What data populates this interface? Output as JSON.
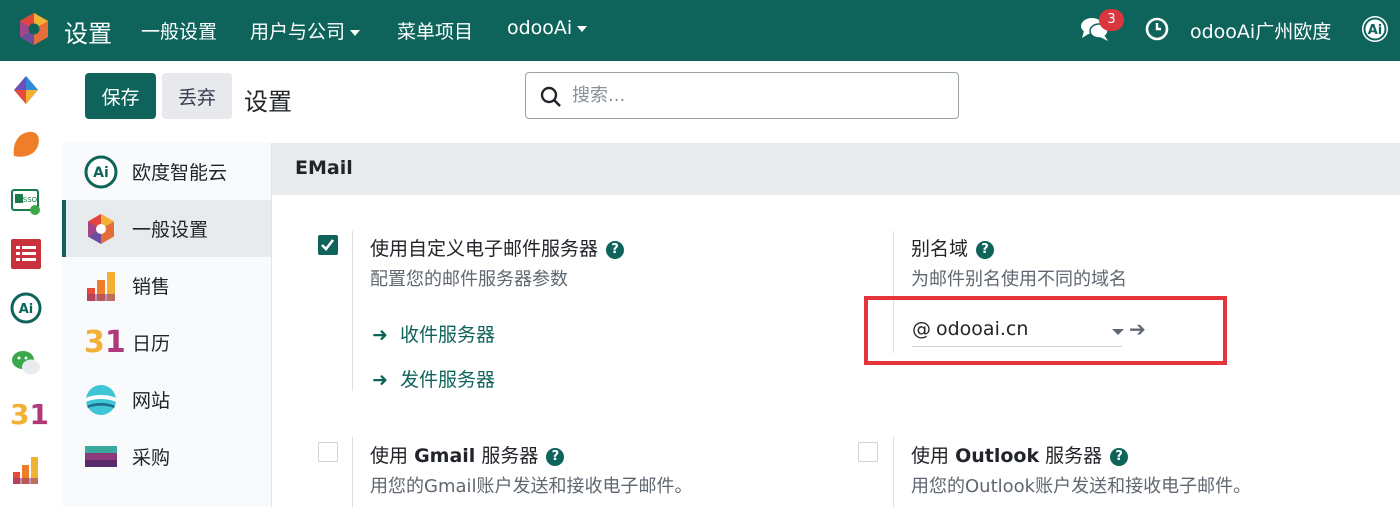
{
  "topbar": {
    "app_title": "设置",
    "nav": [
      {
        "label": "一般设置",
        "has_caret": false
      },
      {
        "label": "用户与公司",
        "has_caret": true
      },
      {
        "label": "菜单项目",
        "has_caret": false
      },
      {
        "label": "odooAi",
        "has_caret": true
      }
    ],
    "message_count": "3",
    "user_name": "odooAi广州欧度"
  },
  "control_panel": {
    "save_label": "保存",
    "discard_label": "丢弃",
    "title": "设置",
    "search_placeholder": "搜索..."
  },
  "sidebar": {
    "items": [
      {
        "label": "欧度智能云",
        "icon": "odoo-ai-icon"
      },
      {
        "label": "一般设置",
        "icon": "general-settings-icon",
        "active": true
      },
      {
        "label": "销售",
        "icon": "sales-icon"
      },
      {
        "label": "日历",
        "icon": "calendar-icon"
      },
      {
        "label": "网站",
        "icon": "website-icon"
      },
      {
        "label": "采购",
        "icon": "purchase-icon"
      }
    ]
  },
  "email_section": {
    "heading": "EMail",
    "custom_server": {
      "checked": true,
      "title": "使用自定义电子邮件服务器",
      "desc": "配置您的邮件服务器参数",
      "links": [
        "收件服务器",
        "发件服务器"
      ]
    },
    "alias": {
      "title": "别名域",
      "desc": "为邮件别名使用不同的域名",
      "at": "@",
      "value": "odooai.cn"
    },
    "gmail": {
      "checked": false,
      "title_prefix": "使用",
      "title_bold": "Gmail",
      "title_suffix": "服务器",
      "desc": "用您的Gmail账户发送和接收电子邮件。"
    },
    "outlook": {
      "checked": false,
      "title_prefix": "使用",
      "title_bold": "Outlook",
      "title_suffix": "服务器",
      "desc": "用您的Outlook账户发送和接收电子邮件。"
    }
  },
  "colors": {
    "brand": "#0e645b",
    "highlight": "#e3353b"
  }
}
